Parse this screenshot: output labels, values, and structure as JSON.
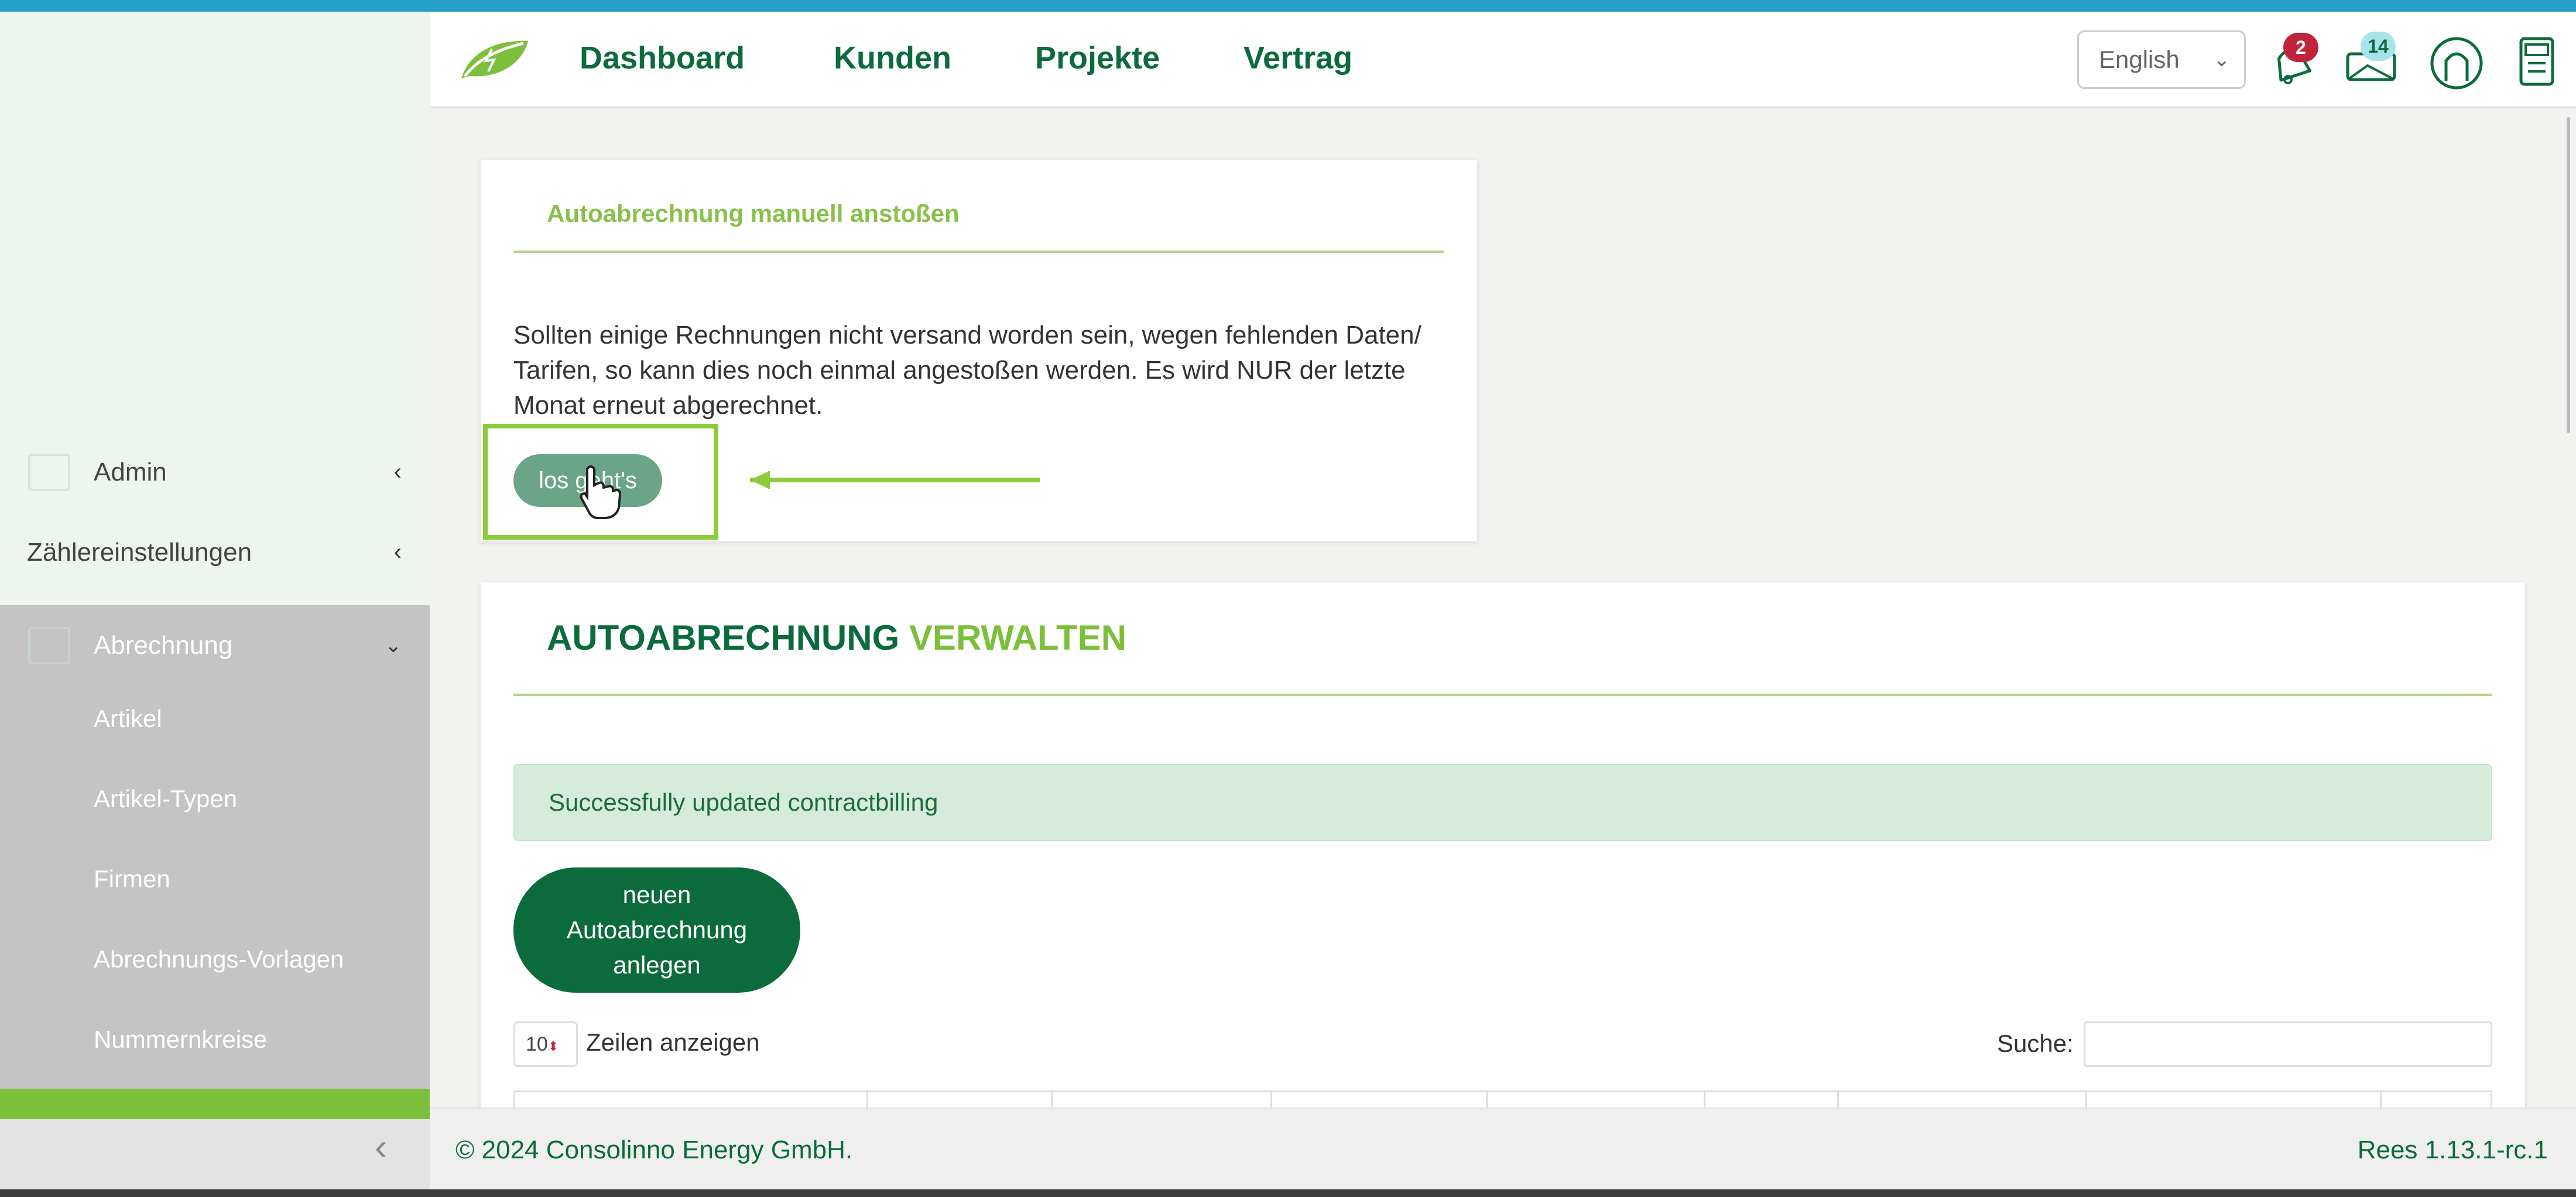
{
  "header": {
    "nav": [
      "Dashboard",
      "Kunden",
      "Projekte",
      "Vertrag"
    ],
    "language": "English",
    "notifications_count": "2",
    "messages_count": "14"
  },
  "sidebar": {
    "items": [
      {
        "label": "Admin"
      },
      {
        "label": "Zählereinstellungen"
      },
      {
        "label": "Abrechnung"
      }
    ],
    "subitems": [
      "Artikel",
      "Artikel-Typen",
      "Firmen",
      "Abrechnungs-Vorlagen",
      "Nummernkreise"
    ]
  },
  "manual_card": {
    "title": "Autoabrechnung manuell anstoßen",
    "text": "Sollten einige Rechnungen nicht versand worden sein, wegen fehlenden Daten/ Tarifen, so kann dies noch einmal angestoßen werden. Es wird NUR der letzte Monat erneut abgerechnet.",
    "button": "los geht's"
  },
  "manage_card": {
    "title_a": "AUTOABRECHNUNG",
    "title_b": "VERWALTEN",
    "alert": "Successfully updated contractbilling",
    "new_button": "neuen Autoabrechnung anlegen",
    "page_length": "10",
    "page_length_label": "Zeilen anzeigen",
    "search_label": "Suche:"
  },
  "footer": {
    "copyright": "© 2024 Consolinno Energy GmbH.",
    "version": "Rees 1.13.1-rc.1"
  },
  "colors": {
    "brand_dark_green": "#0c6b3a",
    "brand_light_green": "#7cbf3a",
    "badge_red": "#c0243c",
    "badge_teal": "#a9e3ea"
  }
}
